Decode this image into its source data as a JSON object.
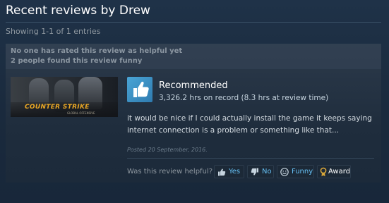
{
  "header": {
    "title": "Recent reviews by Drew"
  },
  "pagination": {
    "showing": "Showing 1-1 of 1 entries"
  },
  "review": {
    "helpful_summary": [
      "No one has rated this review as helpful yet",
      "2 people found this review funny"
    ],
    "game": {
      "logo_text": "COUNTER  STRIKE",
      "logo_subtitle": "GLOBAL OFFENSIVE",
      "icon": "game-capsule-image"
    },
    "recommendation": "Recommended",
    "hours": "3,326.2 hrs on record (8.3 hrs at review time)",
    "text": "it would be nice if I could actually install the game it keeps saying internet connection is a problem or something like that...",
    "posted": "Posted 20 September, 2016.",
    "helpful_question": "Was this review helpful?",
    "buttons": {
      "yes": "Yes",
      "no": "No",
      "funny": "Funny",
      "award": "Award"
    },
    "colors": {
      "background": "#1b2838",
      "accent": "#66c0f4",
      "thumb": "#3e96cc",
      "award_gold": "#d6a53a"
    }
  }
}
